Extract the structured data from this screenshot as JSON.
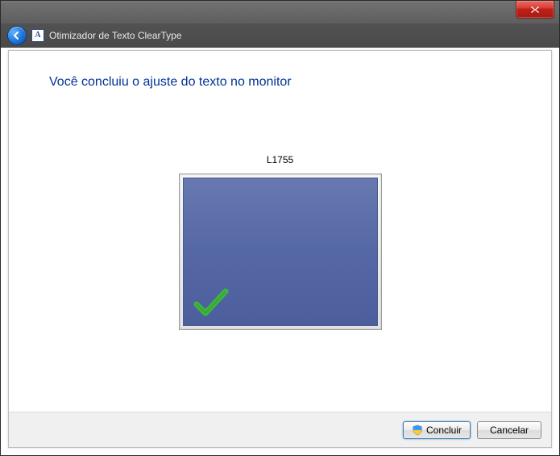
{
  "nav": {
    "title": "Otimizador de Texto ClearType",
    "app_icon_letter": "A"
  },
  "main": {
    "heading": "Você concluiu o ajuste do texto no monitor",
    "monitor_name": "L1755"
  },
  "footer": {
    "finish_label": "Concluir",
    "cancel_label": "Cancelar"
  }
}
